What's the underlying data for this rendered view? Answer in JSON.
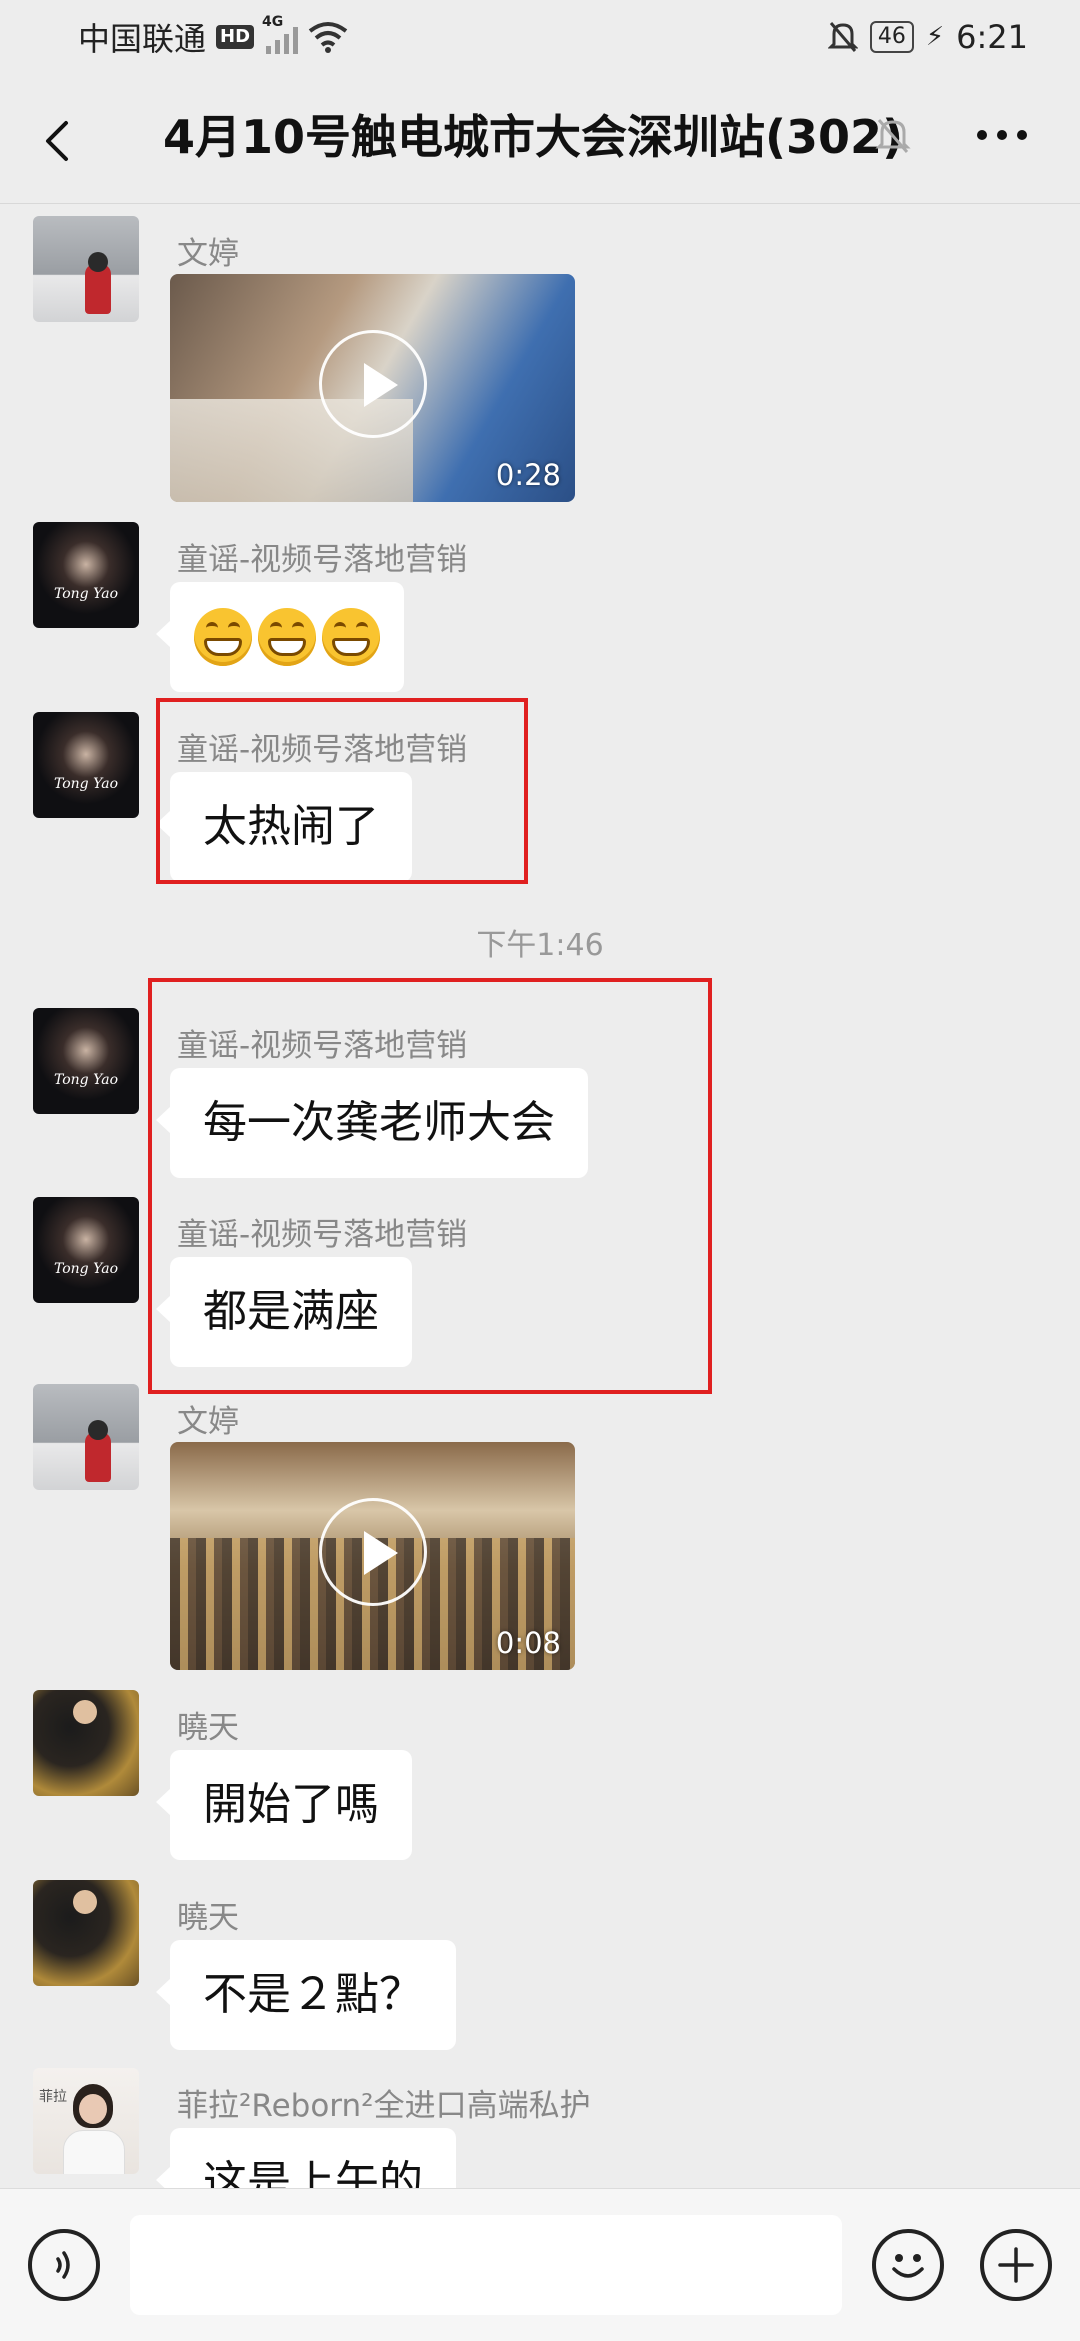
{
  "status_bar": {
    "carrier": "中国联通",
    "hd": "HD",
    "network": "4G",
    "battery": "46",
    "time": "6:21"
  },
  "title_bar": {
    "title": "4月10号触电城市大会深圳站(302)"
  },
  "messages": [
    {
      "sender": "文婷",
      "type": "video",
      "duration": "0:28"
    },
    {
      "sender": "童谣-视频号落地营销",
      "type": "emoji",
      "emoji_count": 3,
      "emoji_name": "grinning-face"
    },
    {
      "sender": "童谣-视频号落地营销",
      "type": "text",
      "text": "太热闹了"
    },
    {
      "sender": "童谣-视频号落地营销",
      "type": "text",
      "text": "每一次龚老师大会"
    },
    {
      "sender": "童谣-视频号落地营销",
      "type": "text",
      "text": "都是满座"
    },
    {
      "sender": "文婷",
      "type": "video",
      "duration": "0:08"
    },
    {
      "sender": "曉天",
      "type": "text",
      "text": "開始了嗎"
    },
    {
      "sender": "曉天",
      "type": "text",
      "text": "不是２點？"
    },
    {
      "sender": "菲拉²Reborn²全进口高端私护",
      "type": "text",
      "text": "这是上午的"
    }
  ],
  "time_divider": "下午1:46",
  "avatar_caption": "Tong Yao",
  "avatar_caption_2": "菲拉",
  "colors": {
    "background": "#ededed",
    "bubble": "#ffffff",
    "highlight": "#e02020",
    "sender": "#888888"
  },
  "icons": [
    "back-arrow-icon",
    "mute-bell-icon",
    "more-dots-icon",
    "voice-icon",
    "emoji-icon",
    "plus-icon",
    "play-icon"
  ]
}
